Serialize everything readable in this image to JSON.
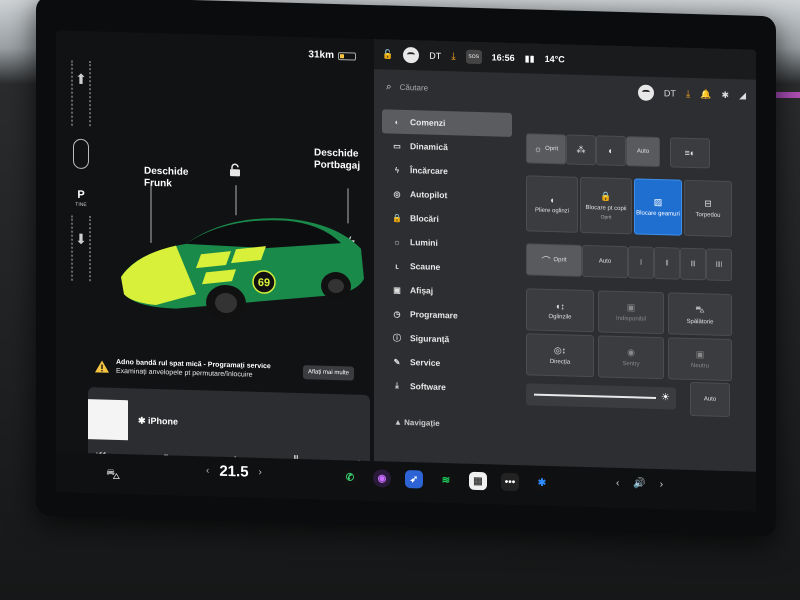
{
  "colors": {
    "accent_blue": "#1f6fd1",
    "car_green": "#1a8a4a",
    "car_yellow": "#d8f03a",
    "warning": "#f5c542",
    "download": "#f5a623"
  },
  "left": {
    "range": "31km",
    "gear": {
      "selected": "P",
      "label": "TINE"
    },
    "frunk": {
      "line1": "Deschide",
      "line2": "Frunk"
    },
    "trunk": {
      "line1": "Deschide",
      "line2": "Portbagaj"
    },
    "car_number": "69",
    "alert": {
      "title": "Adno bandă rul spat mică - Programați service",
      "text": "Examinați anvelopele pt permutare/înlocuire",
      "button": "Aflați mai multe"
    },
    "media": {
      "source": "iPhone"
    }
  },
  "status": {
    "profile": "DT",
    "time": "16:56",
    "temp": "14°C",
    "sos": "SOS"
  },
  "search": {
    "placeholder": "Căutare",
    "profile": "DT"
  },
  "menu": [
    {
      "label": "Comenzi",
      "icon": "toggle-icon",
      "glyph": "◐"
    },
    {
      "label": "Dinamică",
      "icon": "car-icon",
      "glyph": "▭"
    },
    {
      "label": "Încărcare",
      "icon": "bolt-icon",
      "glyph": "ϟ"
    },
    {
      "label": "Autopilot",
      "icon": "steering-icon",
      "glyph": "◎"
    },
    {
      "label": "Blocări",
      "icon": "lock-icon",
      "glyph": "🔒"
    },
    {
      "label": "Lumini",
      "icon": "sun-icon",
      "glyph": "☼"
    },
    {
      "label": "Scaune",
      "icon": "seat-icon",
      "glyph": "ʟ"
    },
    {
      "label": "Afișaj",
      "icon": "display-icon",
      "glyph": "▣"
    },
    {
      "label": "Programare",
      "icon": "clock-icon",
      "glyph": "◷"
    },
    {
      "label": "Siguranță",
      "icon": "info-icon",
      "glyph": "ⓘ"
    },
    {
      "label": "Service",
      "icon": "wrench-icon",
      "glyph": "✎"
    },
    {
      "label": "Software",
      "icon": "download-icon",
      "glyph": "⤓"
    }
  ],
  "menu_partial": "Navigație",
  "lights": {
    "off": "Oprit",
    "auto": "Auto"
  },
  "controls": {
    "mirrors": "Pliere oglinzi",
    "child_lock": "Blocare pt copii",
    "child_lock_sub": "Oprit",
    "window_lock": "Blocare geamuri",
    "glovebox": "Torpedou"
  },
  "wipers": {
    "off": "Oprit",
    "auto": "Auto"
  },
  "adjust": {
    "mirrors": "Oglinzile",
    "unavailable": "Indisponibil",
    "washer": "Spălătorie",
    "steering": "Direcția",
    "sentry": "Sentry",
    "neutral": "Neutru"
  },
  "brightness": {
    "auto": "Auto"
  },
  "climate": {
    "temp": "21.5"
  }
}
